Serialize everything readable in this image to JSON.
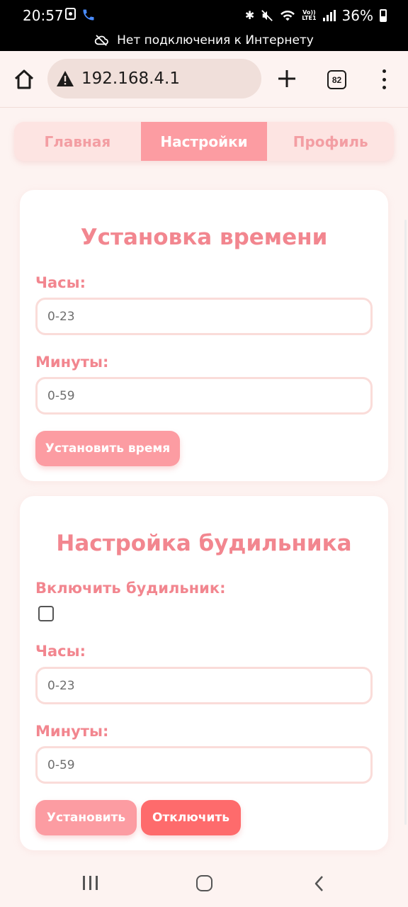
{
  "status_bar": {
    "time": "20:57",
    "battery": "36%",
    "network_message": "Нет подключения к Интернету",
    "icons": [
      "screenshot-icon",
      "phone-icon",
      "bluetooth-icon",
      "mute-icon",
      "wifi-icon",
      "volte-icon",
      "signal-icon",
      "battery-icon"
    ],
    "lte_label": "LTE1",
    "volte_label": "Vo))"
  },
  "browser": {
    "url": "192.168.4.1",
    "tab_count": "82",
    "icons": [
      "home-icon",
      "warning-icon",
      "plus-icon",
      "tabs-icon",
      "menu-icon"
    ]
  },
  "nav_tabs": [
    {
      "label": "Главная",
      "active": false
    },
    {
      "label": "Настройки",
      "active": true
    },
    {
      "label": "Профиль",
      "active": false
    }
  ],
  "time_card": {
    "title": "Установка времени",
    "hours_label": "Часы:",
    "hours_placeholder": "0-23",
    "minutes_label": "Минуты:",
    "minutes_placeholder": "0-59",
    "submit_label": "Установить время"
  },
  "alarm_card": {
    "title": "Настройка будильника",
    "enable_label": "Включить будильник:",
    "enabled": false,
    "hours_label": "Часы:",
    "hours_placeholder": "0-23",
    "minutes_label": "Минуты:",
    "minutes_placeholder": "0-59",
    "set_label": "Установить",
    "disable_label": "Отключить"
  },
  "colors": {
    "accent": "#fc9ca2",
    "danger": "#fe6b6c",
    "text_accent": "#f2868f",
    "background": "#fdf3f1"
  }
}
